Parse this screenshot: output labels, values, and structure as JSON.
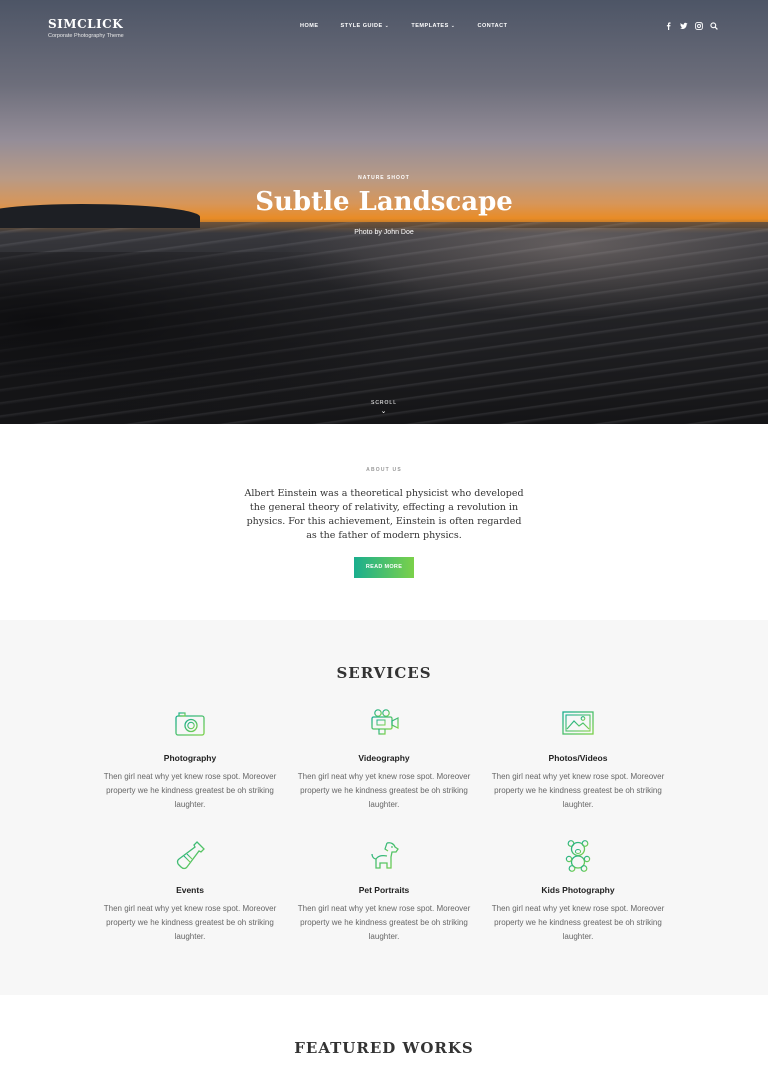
{
  "brand": {
    "name": "SIMCLICK",
    "tagline": "Corporate Photography Theme"
  },
  "nav": {
    "items": [
      {
        "label": "HOME"
      },
      {
        "label": "STYLE GUIDE"
      },
      {
        "label": "TEMPLATES"
      },
      {
        "label": "CONTACT"
      }
    ]
  },
  "social": [
    "facebook-icon",
    "twitter-icon",
    "instagram-icon",
    "search-icon"
  ],
  "hero": {
    "kicker": "NATURE SHOOT",
    "title": "Subtle Landscape",
    "credit": "Photo by John Doe",
    "scroll_label": "SCROLL"
  },
  "about": {
    "label": "ABOUT US",
    "text": "Albert Einstein was a theoretical physicist who developed the general theory of relativity, effecting a revolution in physics. For this achievement, Einstein is often regarded as the father of modern physics.",
    "button_label": "READ MORE"
  },
  "services": {
    "heading": "SERVICES",
    "items": [
      {
        "title": "Photography",
        "icon": "camera-icon",
        "desc": "Then girl neat why yet knew rose spot. Moreover property we he kindness greatest be oh striking laughter."
      },
      {
        "title": "Videography",
        "icon": "video-camera-icon",
        "desc": "Then girl neat why yet knew rose spot. Moreover property we he kindness greatest be oh striking laughter."
      },
      {
        "title": "Photos/Videos",
        "icon": "picture-icon",
        "desc": "Then girl neat why yet knew rose spot. Moreover property we he kindness greatest be oh striking laughter."
      },
      {
        "title": "Events",
        "icon": "bottle-icon",
        "desc": "Then girl neat why yet knew rose spot. Moreover property we he kindness greatest be oh striking laughter."
      },
      {
        "title": "Pet Portraits",
        "icon": "dog-icon",
        "desc": "Then girl neat why yet knew rose spot. Moreover property we he kindness greatest be oh striking laughter."
      },
      {
        "title": "Kids Photography",
        "icon": "teddy-bear-icon",
        "desc": "Then girl neat why yet knew rose spot. Moreover property we he kindness greatest be oh striking laughter."
      }
    ]
  },
  "featured": {
    "heading": "FEATURED WORKS"
  },
  "colors": {
    "accent_start": "#1aae8e",
    "accent_end": "#7bd14a",
    "services_bg": "#f7f7f7"
  }
}
